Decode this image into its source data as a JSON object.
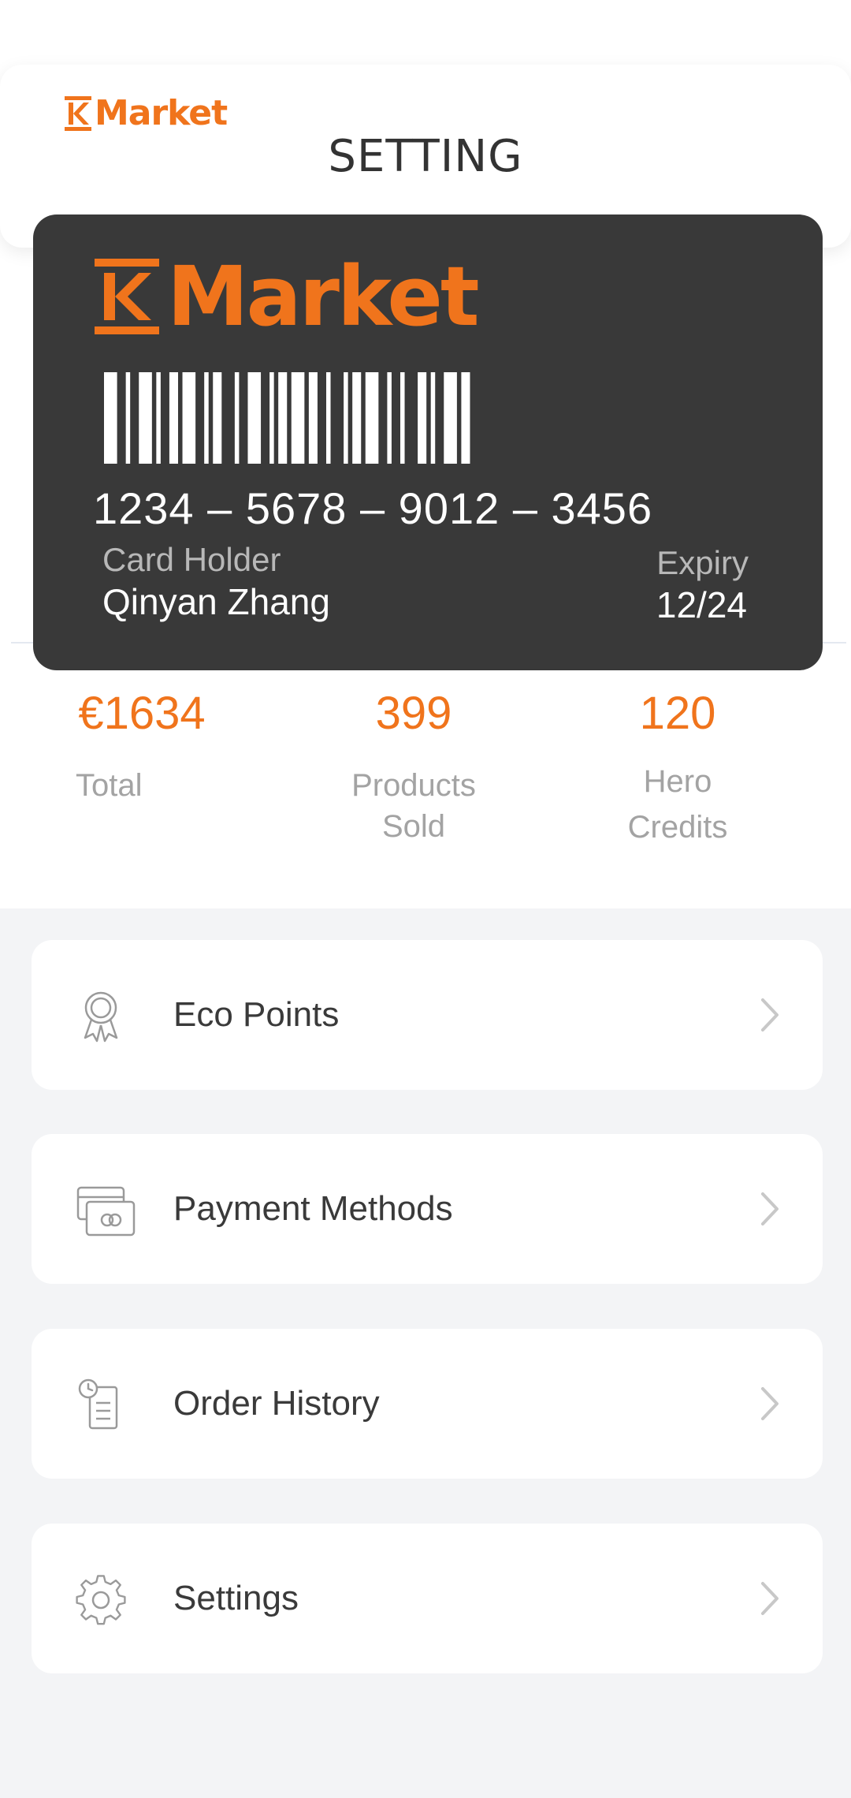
{
  "header": {
    "brand": "Market",
    "title": "SETTING"
  },
  "card": {
    "brand": "Market",
    "number": "1234 – 5678 – 9012 – 3456",
    "holder_label": "Card Holder",
    "holder_name": "Qinyan Zhang",
    "expiry_label": "Expiry",
    "expiry_value": "12/24"
  },
  "stats": {
    "total": {
      "value": "€1634",
      "label": "Total"
    },
    "products": {
      "value": "399",
      "label_line1": "Products",
      "label_line2": "Sold"
    },
    "credits": {
      "value": "120",
      "label_line1": "Hero",
      "label_line2": "Credits"
    }
  },
  "menu": {
    "items": [
      {
        "label": "Eco Points",
        "icon": "award-icon"
      },
      {
        "label": "Payment Methods",
        "icon": "credit-card-icon"
      },
      {
        "label": "Order History",
        "icon": "receipt-clock-icon"
      },
      {
        "label": "Settings",
        "icon": "gear-icon"
      }
    ]
  },
  "colors": {
    "brand_orange": "#f0741c",
    "card_background": "#393939",
    "page_background": "#f3f4f6"
  }
}
